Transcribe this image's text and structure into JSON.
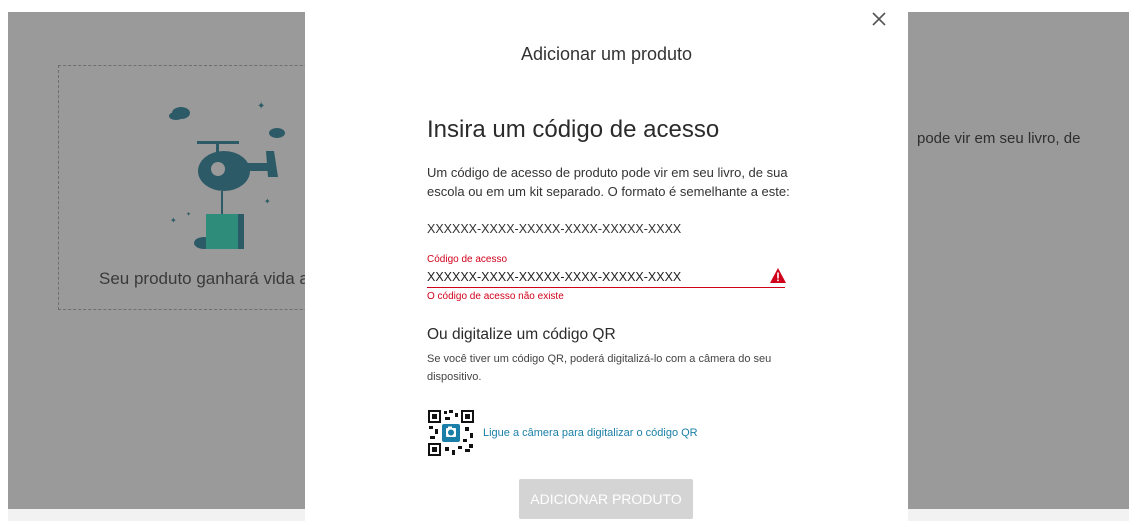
{
  "background": {
    "card_text": "Seu produto ganhará vida a",
    "right_text": "pode vir em seu livro, de"
  },
  "modal": {
    "title": "Adicionar um produto",
    "close_icon": "close-icon",
    "heading": "Insira um código de acesso",
    "description": "Um código de acesso de produto pode vir em seu livro, de sua escola ou em um kit separado. O formato é semelhante a este:",
    "format_sample": "XXXXXX-XXXX-XXXXX-XXXX-XXXXX-XXXX",
    "field": {
      "label": "Código de acesso",
      "value": "XXXXXX-XXXX-XXXXX-XXXX-XXXXX-XXXX",
      "error": "O código de acesso não existe",
      "warning_icon": "warning-icon",
      "error_color": "#d0021b"
    },
    "qr": {
      "heading": "Ou digitalize um código QR",
      "description": "Se você tiver um código QR, poderá digitalizá-lo com a câmera do seu dispositivo.",
      "link": "Ligue a câmera para digitalizar o código QR",
      "icon": "qr-camera-icon",
      "link_color": "#1a7fa8"
    },
    "submit_label": "ADICIONAR PRODUTO"
  }
}
